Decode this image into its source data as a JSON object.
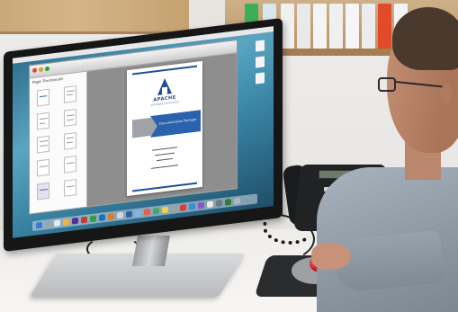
{
  "scene": {
    "description_free": true
  },
  "screen_document": {
    "org_name": "APACHE",
    "org_sub_line1": "SOFTWARE FOUNDATION",
    "ribbon_text": "Documentation Package",
    "panel_title": "Page Thumbnails"
  },
  "colors": {
    "document_blue": "#1f4f94",
    "ribbon_blue": "#2b62ad",
    "trackball_red": "#c01818",
    "desktop_teal": "#3b86a6"
  },
  "icons": {
    "document_logo": "apache-a-logo-icon",
    "dock": "app-dock-icons",
    "desktop": "desktop-file-icon"
  }
}
